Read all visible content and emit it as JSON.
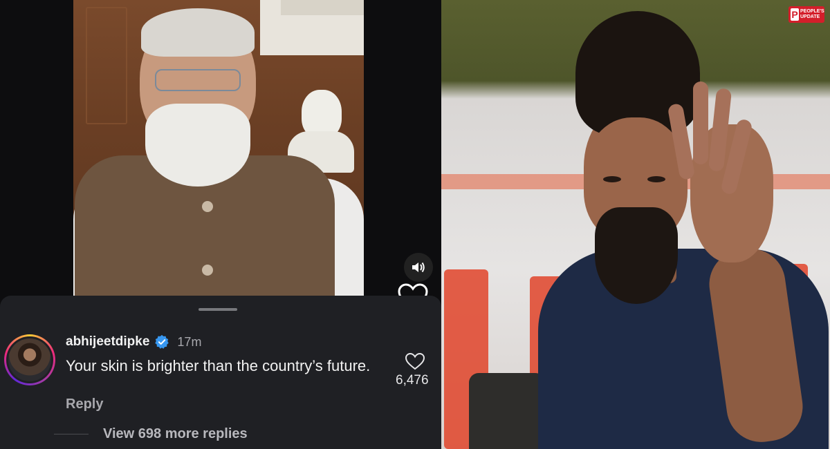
{
  "comment_sheet": {
    "username": "abhijeetdipke",
    "timestamp": "17m",
    "comment_text": "Your skin is brighter than the country’s future.",
    "reply_label": "Reply",
    "like_count": "6,476",
    "view_replies_label": "View 698 more replies",
    "verified": true,
    "verified_color": "#3797f0"
  },
  "video_controls": {
    "sound_icon": "speaker-icon",
    "like_icon": "heart-icon"
  },
  "watermark": {
    "brand_line1": "PEOPLE'S",
    "brand_line2": "UPDATE",
    "brand_color": "#d41e2a"
  },
  "colors": {
    "sheet_bg": "#1f2024",
    "text_primary": "#f2f2f2",
    "text_secondary": "#a8a8ad"
  }
}
